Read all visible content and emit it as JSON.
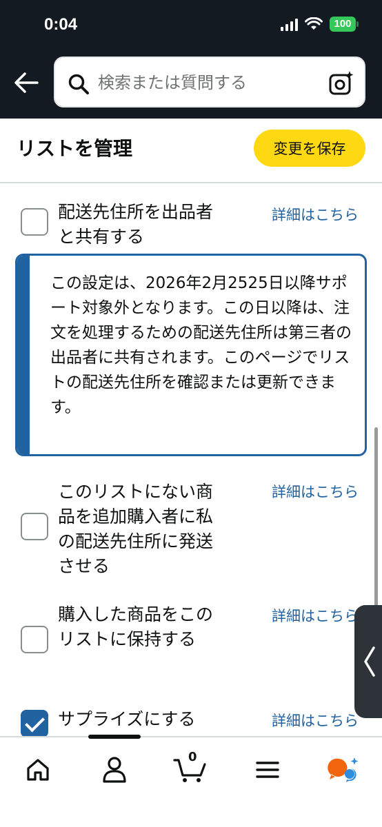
{
  "status_bar": {
    "time": "0:04",
    "battery": "100"
  },
  "search": {
    "placeholder": "検索または質問する"
  },
  "header": {
    "title": "リストを管理",
    "save_label": "変更を保存"
  },
  "settings": [
    {
      "label": "配送先住所を出品者と共有する",
      "link": "詳細はこちら",
      "checked": false
    },
    {
      "label": "このリストにない商品を追加購入者に私の配送先住所に発送させる",
      "link": "詳細はこちら",
      "checked": false
    },
    {
      "label": "購入した商品をこのリストに保持する",
      "link": "詳細はこちら",
      "checked": false
    },
    {
      "label": "サプライズにする",
      "link": "詳細はこちら",
      "checked": true
    }
  ],
  "notice": {
    "text": "この設定は、2026年2月2525日以降サポート対象外となります。この日以降は、注文を処理するための配送先住所は第三者の出品者に共有されます。このページでリストの配送先住所を確認または更新できます。"
  },
  "bottom_nav": {
    "cart_count": "0"
  },
  "colors": {
    "accent": "#2162a1",
    "save_button": "#ffd814",
    "header_bg": "#131a22",
    "battery": "#34c759"
  },
  "icons": [
    "back-arrow-icon",
    "search-icon",
    "camera-icon",
    "home-icon",
    "account-icon",
    "cart-icon",
    "menu-icon",
    "assistant-icon",
    "chevron-left-icon",
    "wifi-icon",
    "signal-icon"
  ]
}
